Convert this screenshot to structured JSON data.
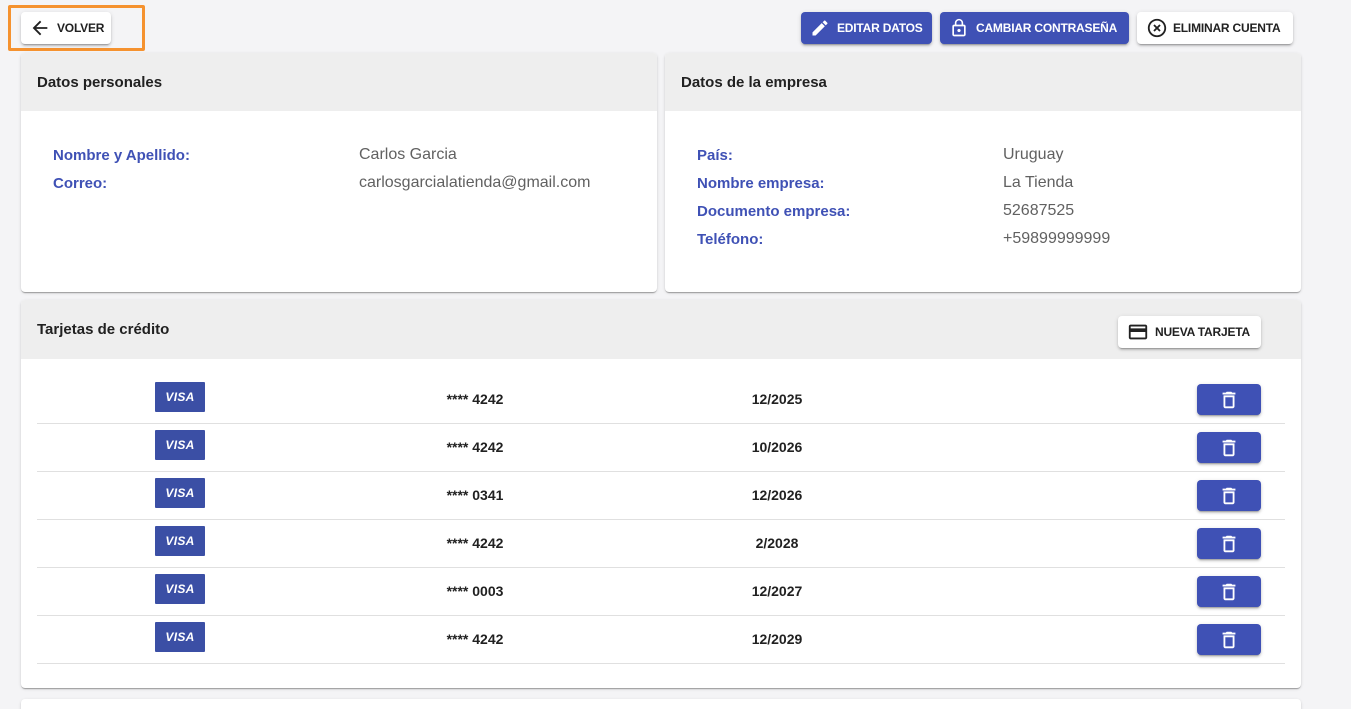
{
  "colors": {
    "primary": "#3f51b5",
    "field_label": "#3f51b5",
    "field_value": "#616161",
    "page_background": "#f4f4f6",
    "card_header": "#eeeeee",
    "focus_outline": "#f5922f",
    "visa_logo": "#3b4fa5"
  },
  "toolbar": {
    "back": {
      "label": "VOLVER",
      "icon": "arrow-left-icon"
    },
    "edit": {
      "label": "EDITAR DATOS",
      "icon": "pencil-icon"
    },
    "change_password": {
      "label": "CAMBIAR CONTRASEÑA",
      "icon": "lock-icon"
    },
    "delete_account": {
      "label": "ELIMINAR CUENTA",
      "icon": "circle-x-icon"
    }
  },
  "personal_data": {
    "title": "Datos personales",
    "fields": [
      {
        "label": "Nombre y Apellido:",
        "value": "Carlos Garcia"
      },
      {
        "label": "Correo:",
        "value": "carlosgarcialatienda@gmail.com"
      }
    ]
  },
  "company_data": {
    "title": "Datos de la empresa",
    "fields": [
      {
        "label": "País:",
        "value": "Uruguay"
      },
      {
        "label": "Nombre empresa:",
        "value": "La Tienda"
      },
      {
        "label": "Documento empresa:",
        "value": "52687525"
      },
      {
        "label": "Teléfono:",
        "value": "+59899999999"
      }
    ]
  },
  "credit_cards": {
    "title": "Tarjetas de crédito",
    "new_card": {
      "label": "NUEVA TARJETA",
      "icon": "credit-card-icon"
    },
    "delete_icon": "trash-icon",
    "rows": [
      {
        "brand": "VISA",
        "number": "**** 4242",
        "expiry": "12/2025"
      },
      {
        "brand": "VISA",
        "number": "**** 4242",
        "expiry": "10/2026"
      },
      {
        "brand": "VISA",
        "number": "**** 0341",
        "expiry": "12/2026"
      },
      {
        "brand": "VISA",
        "number": "**** 4242",
        "expiry": "2/2028"
      },
      {
        "brand": "VISA",
        "number": "**** 0003",
        "expiry": "12/2027"
      },
      {
        "brand": "VISA",
        "number": "**** 4242",
        "expiry": "12/2029"
      }
    ]
  }
}
